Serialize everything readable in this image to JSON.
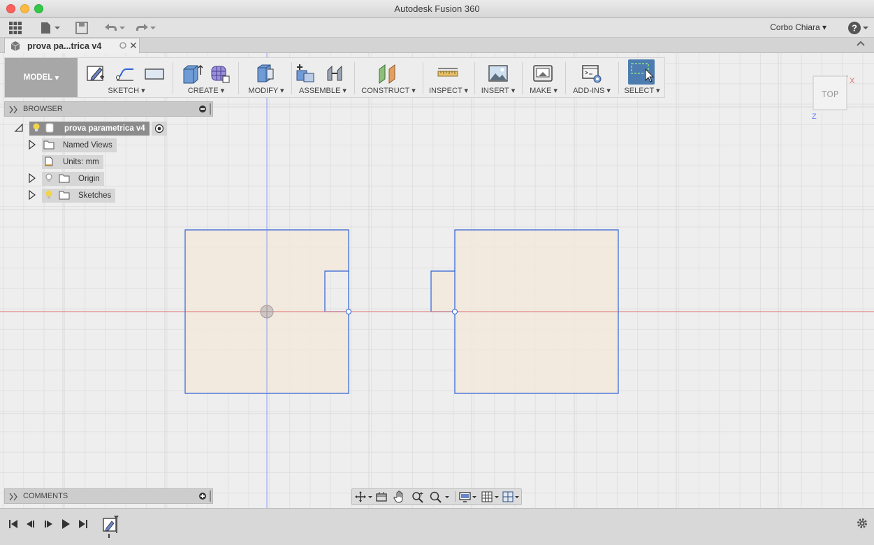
{
  "window": {
    "title": "Autodesk Fusion 360"
  },
  "user": {
    "name": "Corbo Chiara"
  },
  "document_tab": {
    "label": "prova pa...trica v4"
  },
  "ribbon": {
    "workspace": "MODEL",
    "groups": {
      "sketch": "SKETCH",
      "create": "CREATE",
      "modify": "MODIFY",
      "assemble": "ASSEMBLE",
      "construct": "CONSTRUCT",
      "inspect": "INSPECT",
      "insert": "INSERT",
      "make": "MAKE",
      "addins": "ADD-INS",
      "select": "SELECT"
    }
  },
  "browser": {
    "title": "BROWSER",
    "root": "prova parametrica v4",
    "items": {
      "named_views": "Named Views",
      "units": "Units: mm",
      "origin": "Origin",
      "sketches": "Sketches"
    }
  },
  "comments": {
    "title": "COMMENTS"
  },
  "viewcube": {
    "face": "TOP",
    "axis_x": "X",
    "axis_z": "Z"
  },
  "colors": {
    "accent": "#4d7db0",
    "sketch_line": "#2f62d6",
    "sketch_fill": "#f2e8dc",
    "x_axis": "#e07070",
    "y_axis": "#8d9ef0"
  }
}
